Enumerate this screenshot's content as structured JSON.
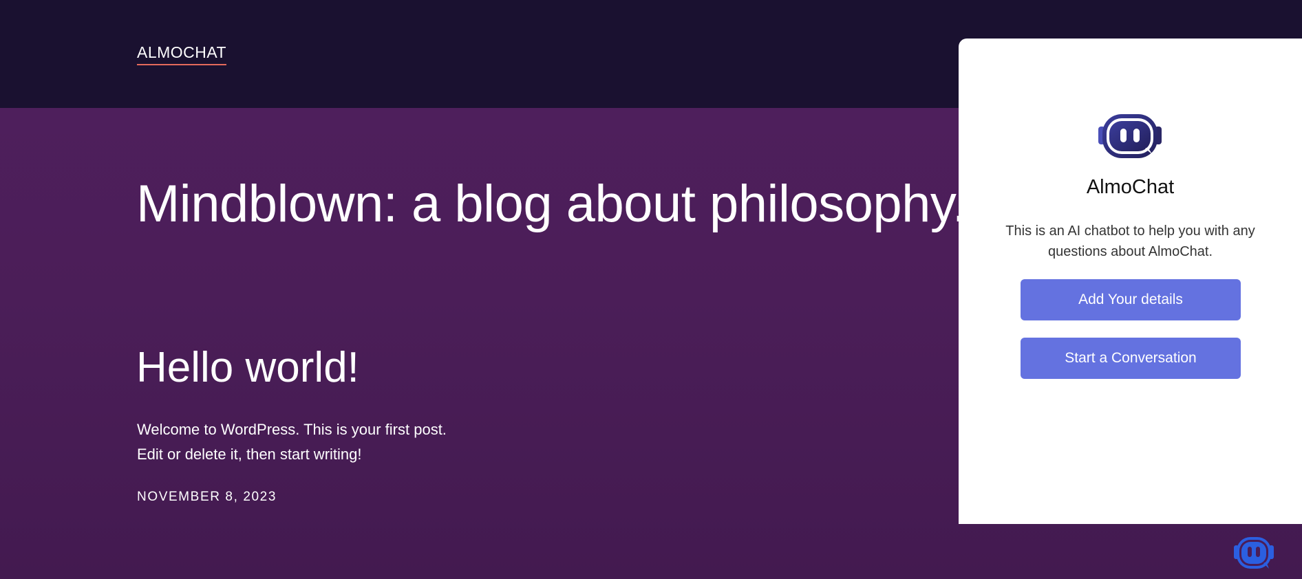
{
  "header": {
    "site_title": "ALMOCHAT"
  },
  "main": {
    "tagline": "Mindblown: a blog about philosophy.",
    "post": {
      "title": "Hello world!",
      "excerpt_line1": "Welcome to WordPress. This is your first post.",
      "excerpt_line2": "Edit or delete it, then start writing!",
      "date": "NOVEMBER 8, 2023"
    }
  },
  "chat_widget": {
    "logo_icon": "robot-head-icon",
    "name": "AlmoChat",
    "description": "This is an AI chatbot to help you with any questions about AlmoChat.",
    "buttons": {
      "add_details": "Add Your details",
      "start_conversation": "Start a Conversation"
    },
    "launcher_icon": "robot-head-icon"
  },
  "colors": {
    "header_bg": "#1a1130",
    "main_bg": "#4e1f5c",
    "accent_underline": "#e56a5c",
    "button_bg": "#6472e0",
    "launcher_blue": "#2b5fe0"
  }
}
